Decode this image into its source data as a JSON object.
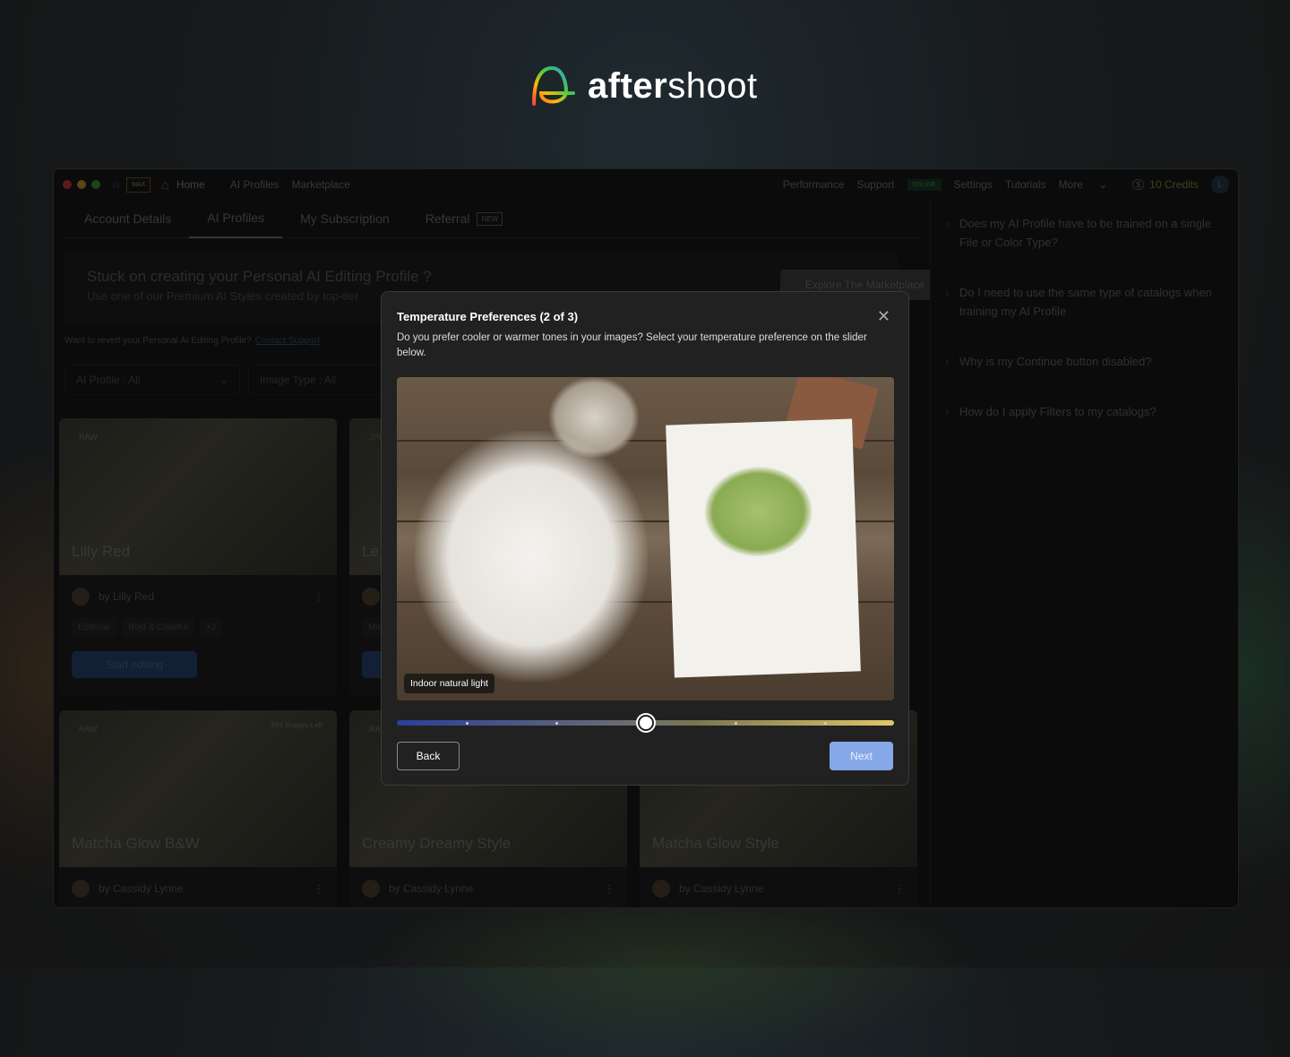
{
  "brand": {
    "name_bold": "after",
    "name_rest": "shoot"
  },
  "topbar": {
    "plan_badge": "MAX",
    "nav": [
      "Home",
      "AI Profiles",
      "Marketplace"
    ],
    "right": [
      "Performance",
      "Support"
    ],
    "status": "ONLINE",
    "right2": [
      "Settings",
      "Tutorials",
      "More"
    ],
    "credits": "10 Credits",
    "avatar": "L"
  },
  "tabs": [
    {
      "label": "Account Details"
    },
    {
      "label": "AI Profiles",
      "active": true
    },
    {
      "label": "My Subscription"
    },
    {
      "label": "Referral",
      "badge": "NEW"
    }
  ],
  "banner": {
    "title": "Stuck on creating your Personal AI Editing Profile ?",
    "subtitle": "Use one of our Premium AI Styles created by top-tier",
    "button": "Explore The Marketplace"
  },
  "revert": {
    "text": "Want to revert your Personal AI Editing Profile?",
    "link": "Contact Support"
  },
  "filters": [
    {
      "label": "AI Profile : ",
      "value": "All"
    },
    {
      "label": "Image Type : ",
      "value": "All"
    }
  ],
  "cards": [
    {
      "type": "RAW",
      "name": "Lilly Red",
      "by": "by Lilly Red",
      "tags": [
        "Editorial",
        "Bold & Colorful",
        "+2"
      ],
      "button": "Start editing"
    },
    {
      "type": "JPG",
      "name": "Le",
      "by": "",
      "tags": [
        "Ma"
      ],
      "button": ""
    },
    {
      "type": "RAW",
      "name": "Matcha Glow B&W",
      "by": "by Cassidy Lynne",
      "images_left": "984 Images Left"
    },
    {
      "type": "RA",
      "name": "Creamy Dreamy Style",
      "by": "by Cassidy Lynne"
    },
    {
      "type": "",
      "name": "Matcha Glow Style",
      "by": "by Cassidy Lynne"
    }
  ],
  "faq": [
    "Does my AI Profile have to be trained on a single File or Color Type?",
    "Do I need to use the same type of catalogs when training my AI Profile",
    "Why is my Continue button disabled?",
    "How do I apply Filters to my catalogs?"
  ],
  "modal": {
    "title": "Temperature Preferences (2 of 3)",
    "description": "Do you prefer cooler or warmer tones in your images? Select your temperature preference on the slider below.",
    "image_caption": "Indoor natural light",
    "slider": {
      "value": 0.5,
      "steps": 7,
      "cool_color": "#2a3f9a",
      "warm_color": "#e0c66a"
    },
    "back": "Back",
    "next": "Next",
    "next_color": "#86a8e8"
  }
}
